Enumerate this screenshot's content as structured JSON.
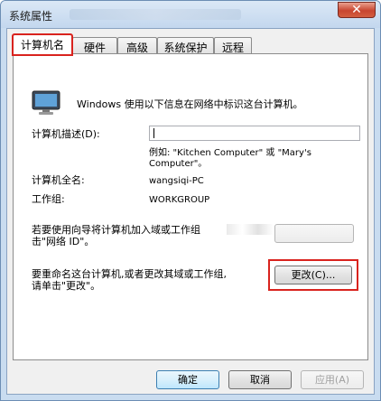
{
  "window": {
    "title": "系统属性",
    "close_glyph": "✕"
  },
  "tabs": [
    {
      "label": "计算机名",
      "active": true
    },
    {
      "label": "硬件"
    },
    {
      "label": "高级"
    },
    {
      "label": "系统保护"
    },
    {
      "label": "远程"
    }
  ],
  "panel": {
    "info_text": "Windows 使用以下信息在网络中标识这台计算机。",
    "description_label": "计算机描述(D):",
    "description_value": "",
    "example_line1": "例如: \"Kitchen Computer\" 或 \"Mary's",
    "example_line2": "Computer\"。",
    "fullname_label": "计算机全名:",
    "fullname_value": "wangsiqi-PC",
    "workgroup_label": "工作组:",
    "workgroup_value": "WORKGROUP",
    "network_id_text_line1": "若要使用向导将计算机加入域或工作组",
    "network_id_text_line2": "击\"网络 ID\"。",
    "rename_text_line1": "要重命名这台计算机,或者更改其域或工作组,",
    "rename_text_line2": "请单击\"更改\"。",
    "change_button": "更改(C)..."
  },
  "buttons": {
    "ok": "确定",
    "cancel": "取消",
    "apply": "应用(A)"
  },
  "colors": {
    "highlight": "#d9231e",
    "titlebar": "#c9dcf0"
  },
  "icons": {
    "computer": "computer-monitor-icon",
    "close": "close-icon"
  }
}
